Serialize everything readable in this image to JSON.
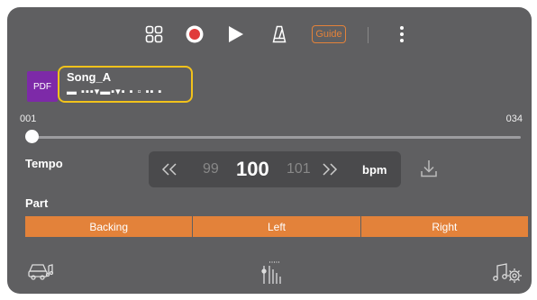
{
  "toolbar": {
    "icons": [
      "grid-icon",
      "record-icon",
      "play-icon",
      "metronome-icon",
      "more-icon"
    ],
    "guide_label": "Guide",
    "record_color": "#e03b3b"
  },
  "song": {
    "badge": "PDF",
    "name": "Song_A",
    "subtitle": "▬ ▪▪▪▾▬▪▾▪ ▪ ▫ ▪▪ ▪"
  },
  "measure": {
    "start": "001",
    "end": "034",
    "position": 0
  },
  "tempo": {
    "label": "Tempo",
    "prev": "99",
    "current": "100",
    "next": "101",
    "unit": "bpm"
  },
  "part": {
    "label": "Part",
    "options": [
      "Backing",
      "Left",
      "Right"
    ]
  },
  "colors": {
    "accent": "#e3823a",
    "highlight": "#f2c21b",
    "pdf_badge": "#7d2aa8",
    "panel": "#5f5f61"
  }
}
